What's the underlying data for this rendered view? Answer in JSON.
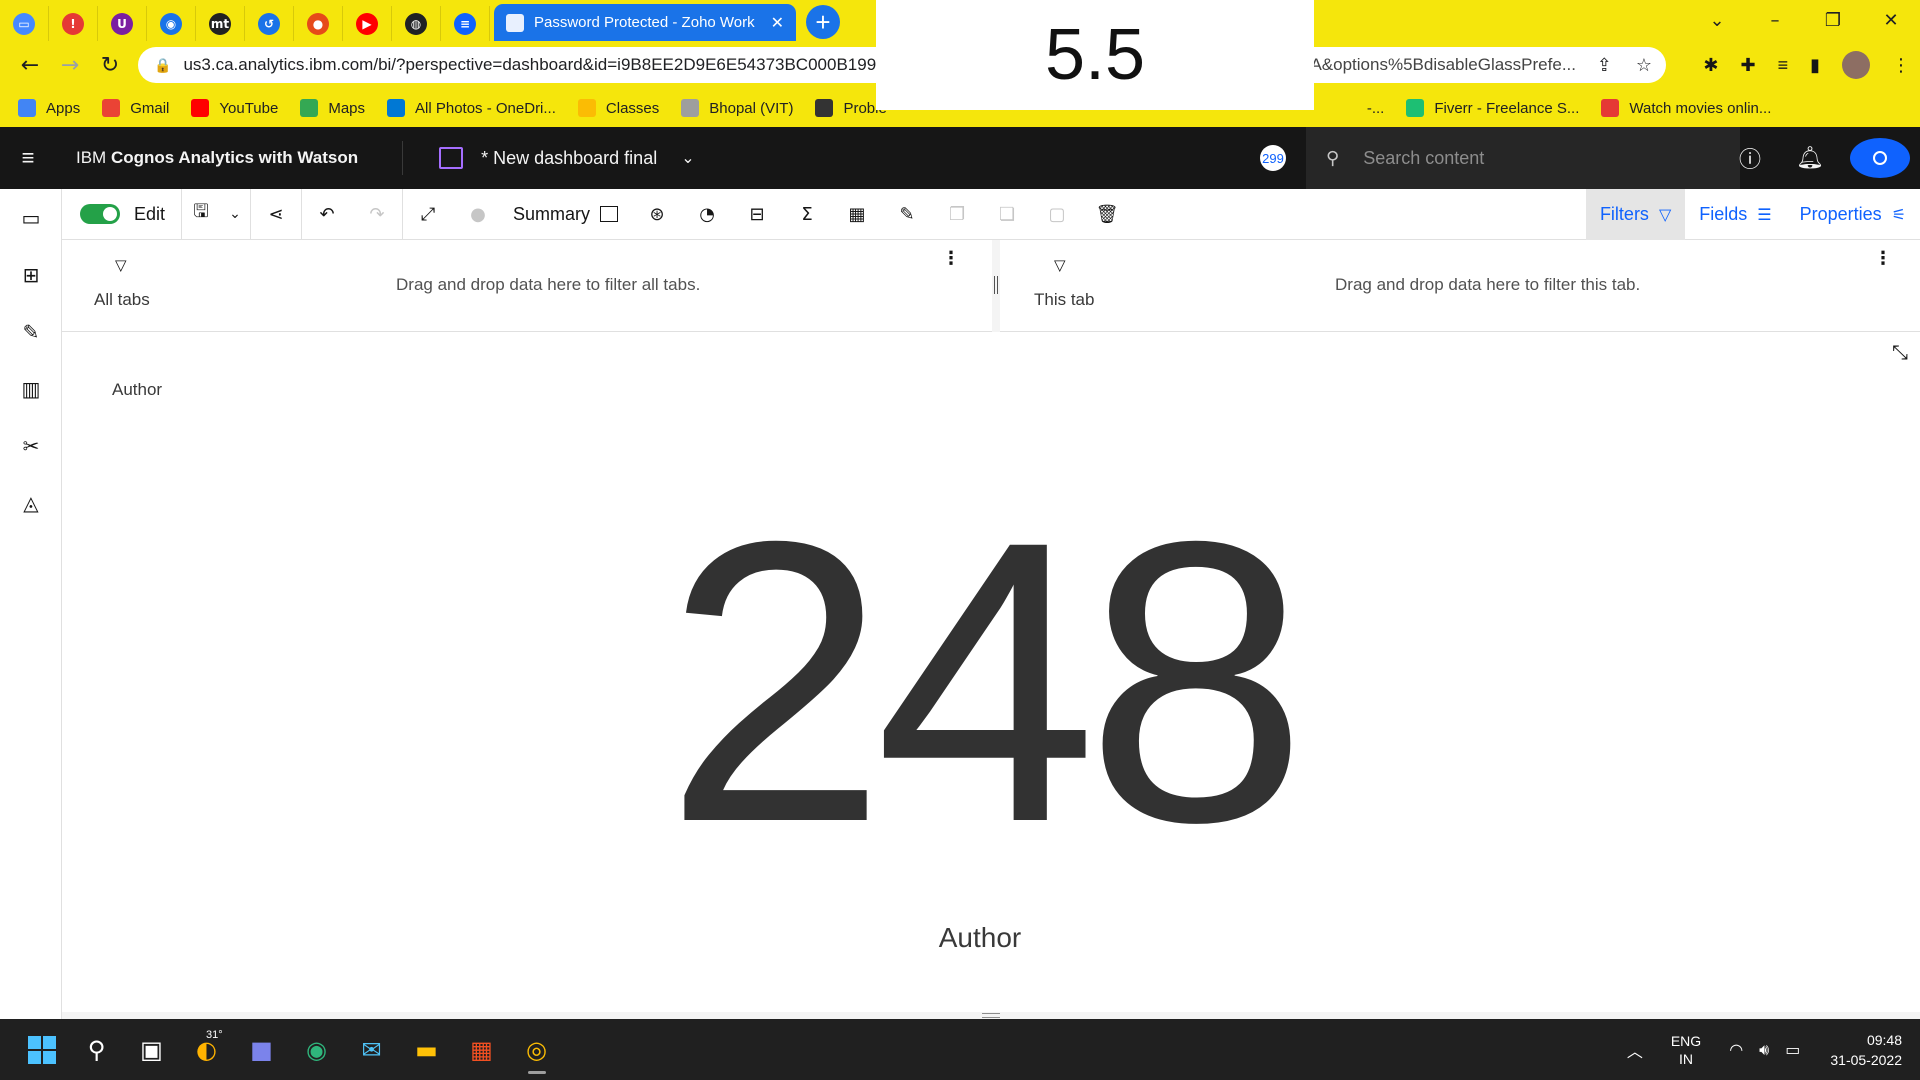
{
  "browser": {
    "pinned_tabs": [
      {
        "icon": "ibm-icon",
        "color": "#4589ff",
        "glyph": "▭"
      },
      {
        "icon": "alert-icon",
        "color": "#e53935",
        "glyph": "!"
      },
      {
        "icon": "u-icon",
        "color": "#7b1fa2",
        "glyph": "U"
      },
      {
        "icon": "github-icon",
        "color": "#1a73e8",
        "glyph": "◉"
      },
      {
        "icon": "mt-icon",
        "color": "#222222",
        "glyph": "mt"
      },
      {
        "icon": "arrow-icon",
        "color": "#1a73e8",
        "glyph": "↺"
      },
      {
        "icon": "firefox-icon",
        "color": "#e64a19",
        "glyph": "●"
      },
      {
        "icon": "youtube-icon",
        "color": "#ff0000",
        "glyph": "▶"
      },
      {
        "icon": "globe-icon",
        "color": "#202124",
        "glyph": "◍"
      },
      {
        "icon": "cognos-icon",
        "color": "#0f62fe",
        "glyph": "≡"
      }
    ],
    "active_tab_title": "Password Protected - Zoho Work",
    "url": "us3.ca.analytics.ibm.com/bi/?perspective=dashboard&id=i9B8EE2D9E6E54373BC000B1998",
    "url_tail": "A&options%5BdisableGlassPrefe...",
    "bookmarks": [
      {
        "label": "Apps",
        "color": "#4285f4"
      },
      {
        "label": "Gmail",
        "color": "#ea4335"
      },
      {
        "label": "YouTube",
        "color": "#ff0000"
      },
      {
        "label": "Maps",
        "color": "#34a853"
      },
      {
        "label": "All Photos - OneDri...",
        "color": "#0078d4"
      },
      {
        "label": "Classes",
        "color": "#fbbc04"
      },
      {
        "label": "Bhopal (VIT)",
        "color": "#9e9e9e"
      },
      {
        "label": "Proble",
        "color": "#333333"
      },
      {
        "label": "-...",
        "color": "#f5e60c"
      },
      {
        "label": "Fiverr - Freelance S...",
        "color": "#1dbf73"
      },
      {
        "label": "Watch movies onlin...",
        "color": "#e53935"
      }
    ]
  },
  "overlay_value": "5.5",
  "header": {
    "app_name_prefix": "IBM ",
    "app_name_bold": "Cognos Analytics with Watson",
    "dashboard_title": "* New dashboard final",
    "notification_count": "299",
    "search_placeholder": "Search content"
  },
  "toolbar": {
    "edit_label": "Edit",
    "summary_label": "Summary",
    "filters_label": "Filters",
    "fields_label": "Fields",
    "properties_label": "Properties"
  },
  "filters": {
    "all_tabs_label": "All tabs",
    "all_tabs_hint": "Drag and drop data here to filter all tabs.",
    "this_tab_label": "This tab",
    "this_tab_hint": "Drag and drop data here to filter this tab."
  },
  "widget": {
    "title": "Author",
    "value": "248",
    "label": "Author"
  },
  "taskbar": {
    "weather_temp": "31°",
    "lang_top": "ENG",
    "lang_bottom": "IN",
    "time": "09:48",
    "date": "31-05-2022"
  }
}
